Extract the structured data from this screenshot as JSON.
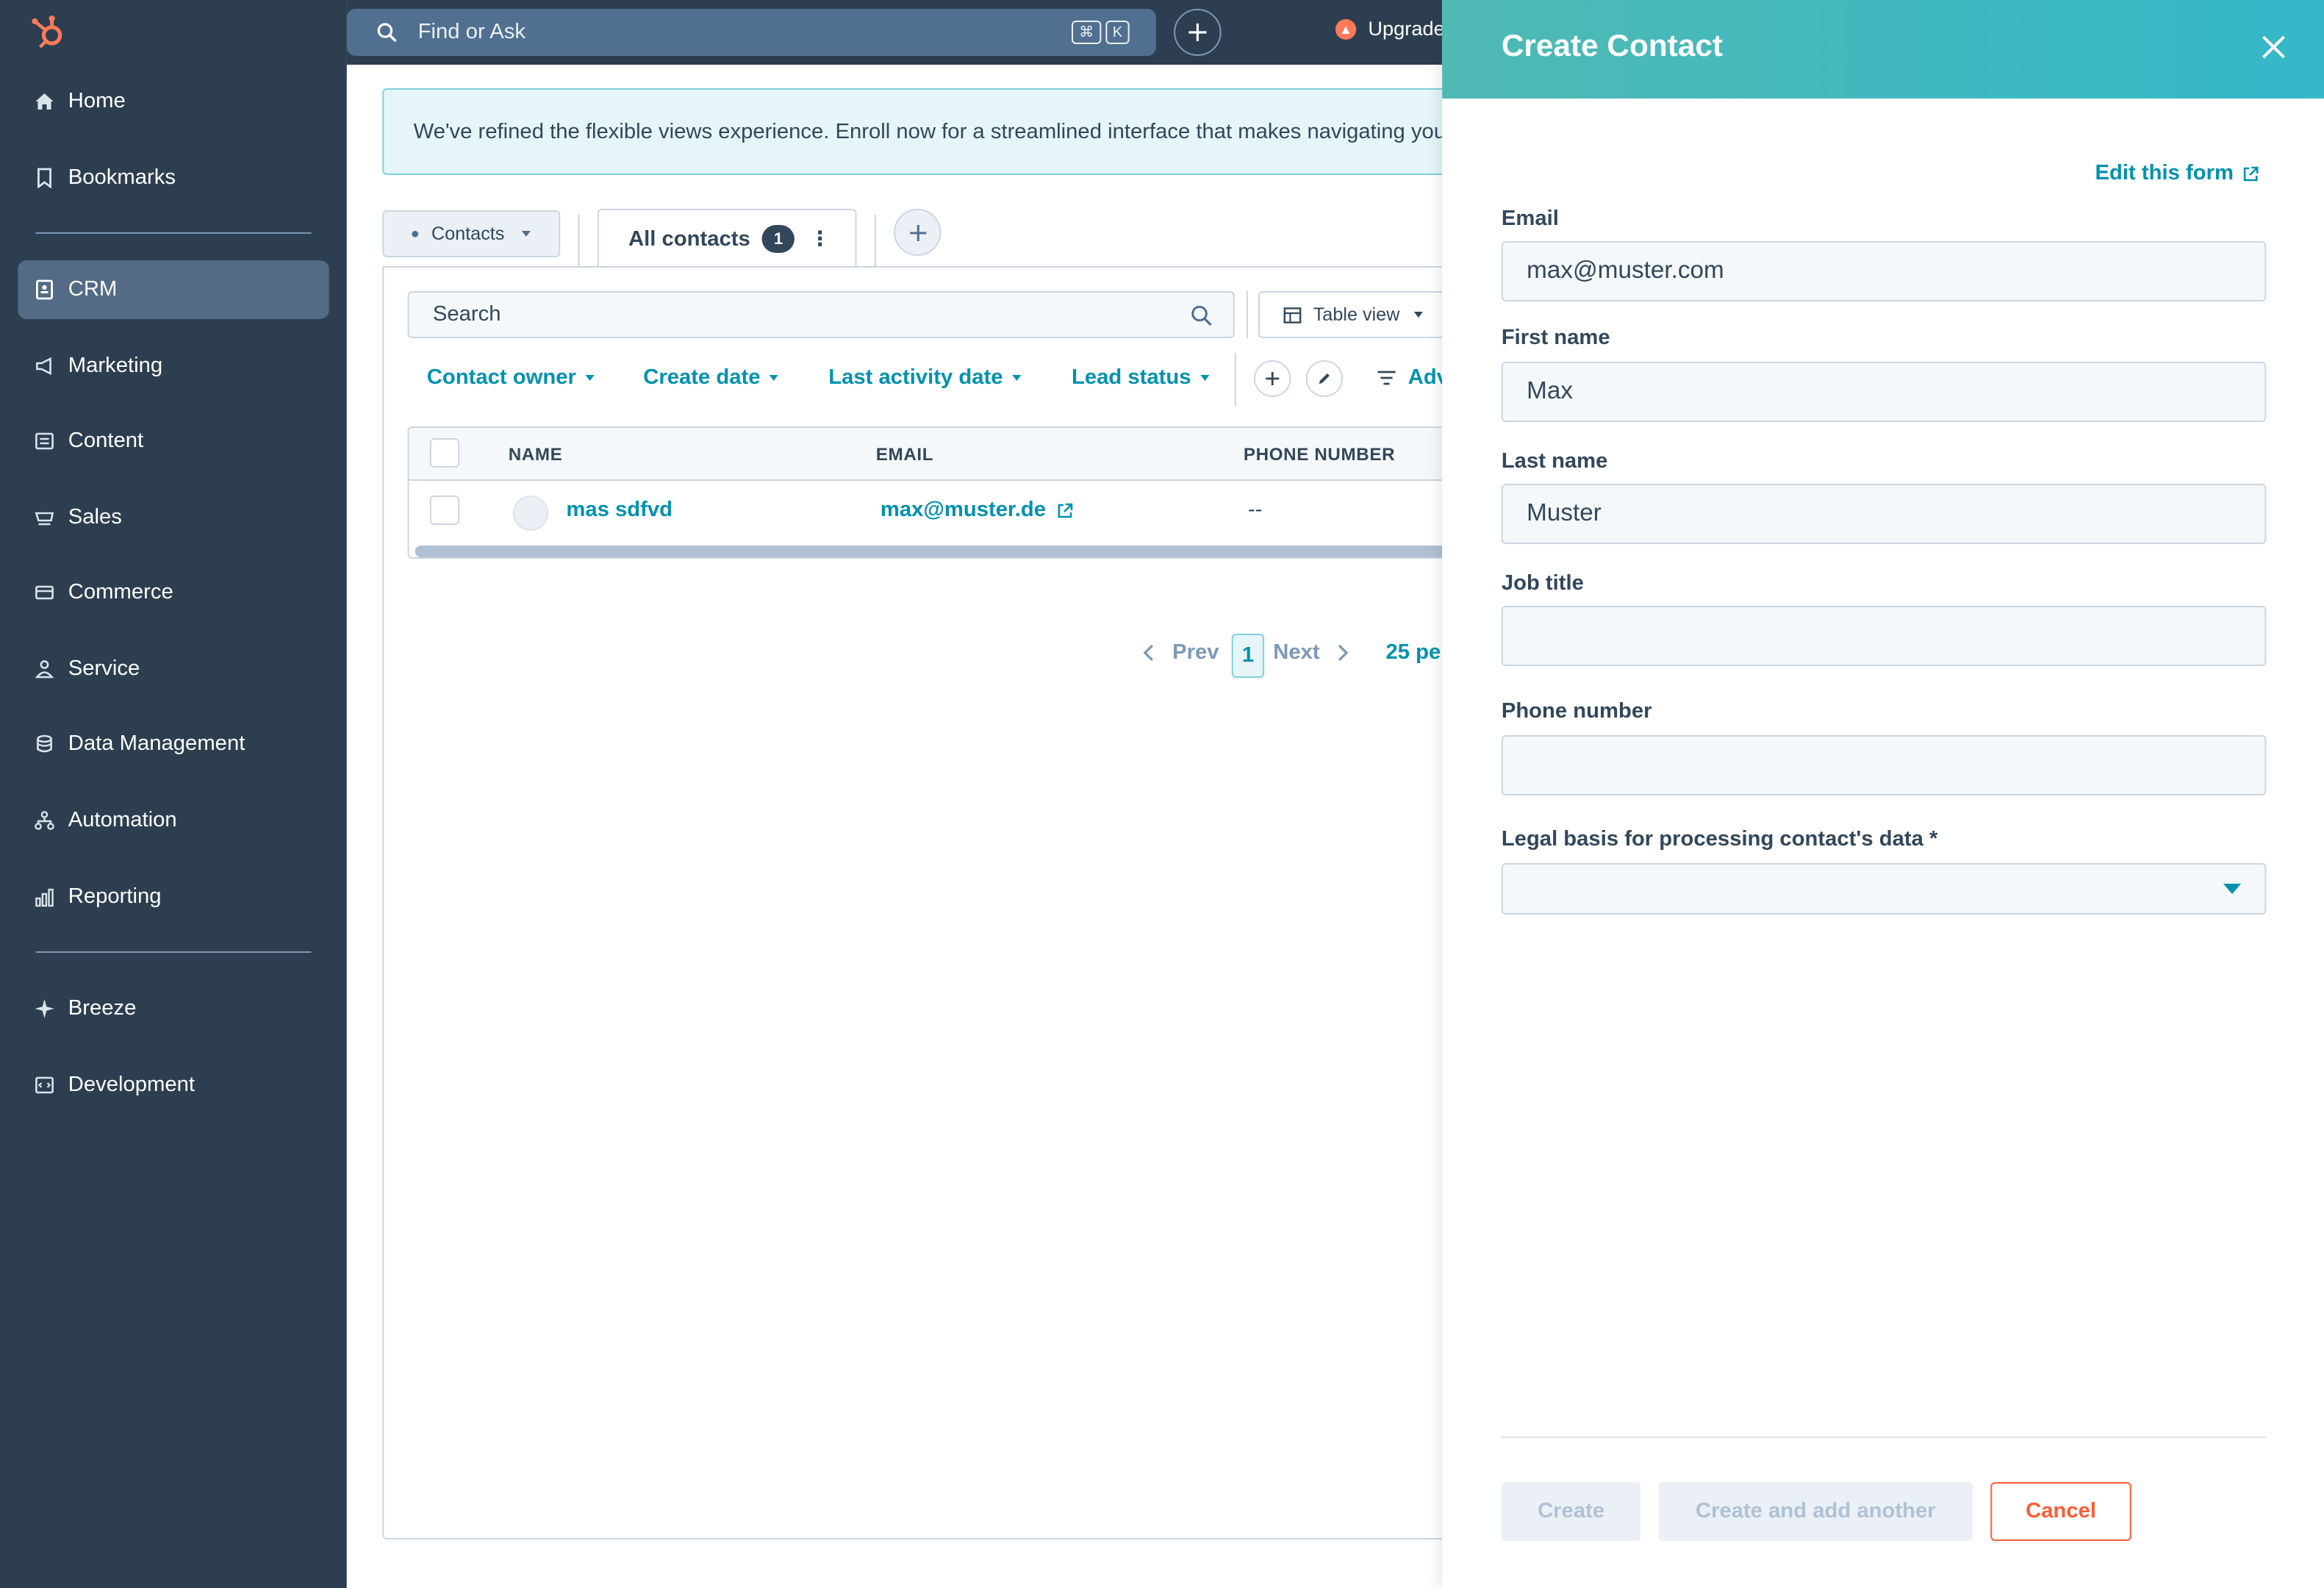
{
  "sidebar": {
    "items": [
      {
        "label": "Home",
        "icon": "home-icon"
      },
      {
        "label": "Bookmarks",
        "icon": "bookmark-icon"
      },
      {
        "label": "CRM",
        "icon": "crm-icon",
        "active": true
      },
      {
        "label": "Marketing",
        "icon": "megaphone-icon"
      },
      {
        "label": "Content",
        "icon": "content-icon"
      },
      {
        "label": "Sales",
        "icon": "sales-icon"
      },
      {
        "label": "Commerce",
        "icon": "commerce-icon"
      },
      {
        "label": "Service",
        "icon": "service-icon"
      },
      {
        "label": "Data Management",
        "icon": "database-icon"
      },
      {
        "label": "Automation",
        "icon": "automation-icon"
      },
      {
        "label": "Reporting",
        "icon": "reporting-icon"
      },
      {
        "label": "Breeze",
        "icon": "sparkle-icon"
      },
      {
        "label": "Development",
        "icon": "code-icon"
      }
    ]
  },
  "topbar": {
    "search_placeholder": "Find or Ask",
    "shortcut_cmd": "⌘",
    "shortcut_key": "K",
    "upgrade_label": "Upgrade"
  },
  "main": {
    "banner_text": "We've refined the flexible views experience. Enroll now for a streamlined interface that makes navigating your",
    "object_selector": "Contacts",
    "view_tab_label": "All contacts",
    "view_tab_count": "1",
    "search_placeholder": "Search",
    "table_view_label": "Table view",
    "filters": [
      "Contact owner",
      "Create date",
      "Last activity date",
      "Lead status"
    ],
    "advanced_label": "Adv",
    "columns": [
      "NAME",
      "EMAIL",
      "PHONE NUMBER"
    ],
    "rows": [
      {
        "name": "mas sdfvd",
        "email": "max@muster.de",
        "phone": "--"
      }
    ],
    "pager": {
      "prev": "Prev",
      "current": "1",
      "next": "Next",
      "per_page": "25 pe"
    }
  },
  "panel": {
    "title": "Create Contact",
    "edit_form_label": "Edit this form",
    "fields": {
      "email": {
        "label": "Email",
        "value": "max@muster.com"
      },
      "first_name": {
        "label": "First name",
        "value": "Max"
      },
      "last_name": {
        "label": "Last name",
        "value": "Muster"
      },
      "job_title": {
        "label": "Job title",
        "value": ""
      },
      "phone": {
        "label": "Phone number",
        "value": ""
      },
      "legal_basis": {
        "label": "Legal basis for processing contact's data *",
        "value": ""
      }
    },
    "buttons": {
      "create": "Create",
      "create_another": "Create and add another",
      "cancel": "Cancel"
    }
  },
  "colors": {
    "sidebar_bg": "#2d3e50",
    "accent_teal": "#0091ae",
    "header_gradient_start": "#4fb9b3",
    "cancel_orange": "#ff5c35",
    "hubspot_orange": "#ff7a59"
  }
}
